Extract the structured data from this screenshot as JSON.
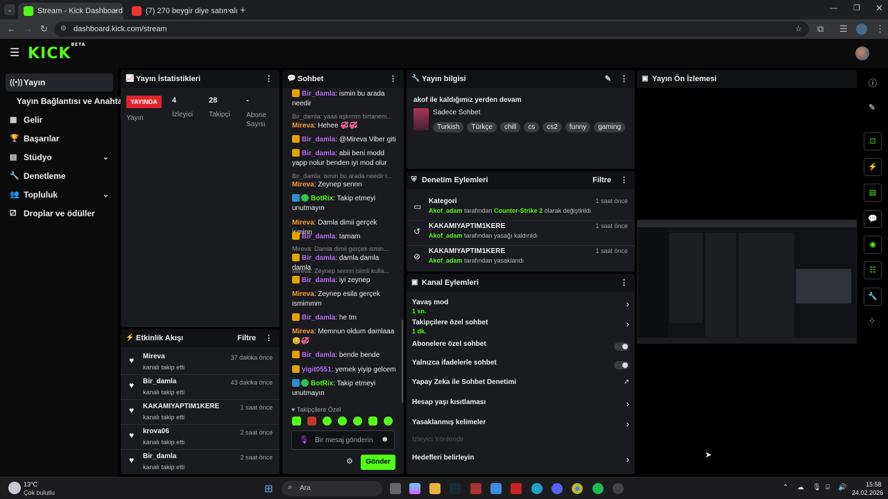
{
  "browser": {
    "tabs": [
      {
        "title": "Stream - Kick Dashboard",
        "active": true
      },
      {
        "title": "(7) 270 beygir diye satın alınan",
        "active": false
      }
    ],
    "url": "dashboard.kick.com/stream"
  },
  "app": {
    "logo": "KICK",
    "logo_badge": "BETA",
    "accent": "#53fc18"
  },
  "sidebar": {
    "items": [
      {
        "label": "Yayın",
        "icon": "broadcast-icon"
      },
      {
        "label": "Yayın Bağlantısı ve Anahtarı"
      },
      {
        "label": "Gelir",
        "icon": "chart-icon"
      },
      {
        "label": "Başarılar",
        "icon": "trophy-icon"
      },
      {
        "label": "Stüdyo",
        "icon": "studio-icon"
      },
      {
        "label": "Denetleme",
        "icon": "wrench-icon"
      },
      {
        "label": "Topluluk",
        "icon": "community-icon"
      },
      {
        "label": "Droplar ve ödüller",
        "icon": "drops-icon"
      }
    ]
  },
  "stats": {
    "title": "Yayın İstatistikleri",
    "live_badge": "YAYINDA",
    "live_label": "Yayın",
    "viewers_value": "4",
    "viewers_label": "İzleyici",
    "followers_value": "28",
    "followers_label": "Takipçi",
    "subs_value": "-",
    "subs_label": "Abone Sayısı"
  },
  "activity": {
    "title": "Etkinlik Akışı",
    "filter": "Filtre",
    "events": [
      {
        "name": "Mireva",
        "sub": "kanalı takip etti",
        "time": "37 dakika önce"
      },
      {
        "name": "Bir_damla",
        "sub": "kanalı takip etti",
        "time": "43 dakika önce"
      },
      {
        "name": "KAKAMIYAPTIM1KERE",
        "sub": "kanalı takip etti",
        "time": "1 saat önce"
      },
      {
        "name": "krova06",
        "sub": "kanalı takip etti",
        "time": "2 saat önce"
      },
      {
        "name": "Bir_damla",
        "sub": "kanalı takip etti",
        "time": "2 saat önce"
      }
    ]
  },
  "chat": {
    "title": "Sohbet",
    "m1_user": "Bir_damla",
    "m1_text": ": ismin bu arada needir",
    "r1": "Bir_damla: yaaa aşkımm birtanem...",
    "m2_user": "Mireva",
    "m2_text": ": Hehee 💞💞",
    "m3_user": "Bir_damla",
    "m3_text": ": @Mireva Viber giti",
    "m4_user": "Bir_damla",
    "m4_text": ": abii beni modd yapp nolur benden iyi mod olur",
    "r2": "Bir_damla: ismin bu arada needir i...",
    "m5_user": "Mireva",
    "m5_text": ": Zeynep sennn",
    "m6_user": "BotRix",
    "m6_text": ": Takip etmeyi unutmayın",
    "m7_user": "Mireva",
    "m7_text": ": Damla dimii gerçek isminn",
    "m8_user": "Bir_damla",
    "m8_text": ": tamam",
    "r3": "Mireva: Damla dimii gerçek ismin...",
    "m9_user": "Bir_damla",
    "m9_text": ": damla damla damla",
    "r4": "Mireva: Zeynep sennn isimli kulla...",
    "m10_user": "Bir_damla",
    "m10_text": ": iyi zeynep",
    "m11_user": "Mireva",
    "m11_text": ": Zeynep esila gerçek ismimmm",
    "m12_user": "Bir_damla",
    "m12_text": ": he tm",
    "m13_user": "Mireva",
    "m13_text": ": Memnun oldum damlaaa 😊💞",
    "m14_user": "Bir_damla",
    "m14_text": ": bende bende",
    "m15_user": "yigit0551",
    "m15_text": ": yemek yiyip gelcem",
    "m16_user": "BotRix",
    "m16_text": ": Takip etmeyi unutmayın",
    "followers_only": "Takipçilere Özel",
    "input_placeholder": "Bir mesaj gönderin",
    "send": "Gönder"
  },
  "stream_info": {
    "title": "Yayın bilgisi",
    "stream_title": "akof ile kaldığımız yerden devam",
    "category": "Sadece Sohbet",
    "tags": [
      "Turkish",
      "Türkçe",
      "chill",
      "cs",
      "cs2",
      "funny",
      "gaming"
    ]
  },
  "moderation": {
    "title": "Denetim Eylemleri",
    "filter": "Filtre",
    "items": [
      {
        "title": "Kategori",
        "actor": "Akof_adam",
        "mid": " tarafından ",
        "target": "Counter-Strike 2",
        "rest": " olarak değiştirildi",
        "time": "1 saat önce"
      },
      {
        "title": "KAKAMIYAPTIM1KERE",
        "actor": "Akof_adam",
        "mid": " tarafından yasağı kaldırıldı",
        "target": "",
        "rest": "",
        "time": "1 saat önce"
      },
      {
        "title": "KAKAMIYAPTIM1KERE",
        "actor": "Akof_adam",
        "mid": " tarafından yasaklandı",
        "target": "",
        "rest": "",
        "time": "1 saat önce"
      }
    ]
  },
  "channel": {
    "title": "Kanal Eylemleri",
    "slow_mode": "Yavaş mod",
    "slow_mode_val": "1 sn.",
    "followers_chat": "Takipçilere özel sohbet",
    "followers_chat_val": "1 dk.",
    "subs_chat": "Abonelere özel sohbet",
    "emotes_chat": "Yalnızca ifadelerle sohbet",
    "ai_mod": "Yapay Zeka ile Sohbet Denetimi",
    "age_restrict": "Hesap yaşı kısıtlaması",
    "banned_words": "Yasaklanmış kelimeler",
    "viewer_redirect": "İzleyici Yönlendir",
    "goals": "Hedefleri belirleyin"
  },
  "preview": {
    "title": "Yayın Ön İzlemesi"
  },
  "taskbar": {
    "weather_temp": "13°C",
    "weather_desc": "Çok bulutlu",
    "search": "Ara",
    "time": "15:58",
    "date": "24.02.2026"
  }
}
